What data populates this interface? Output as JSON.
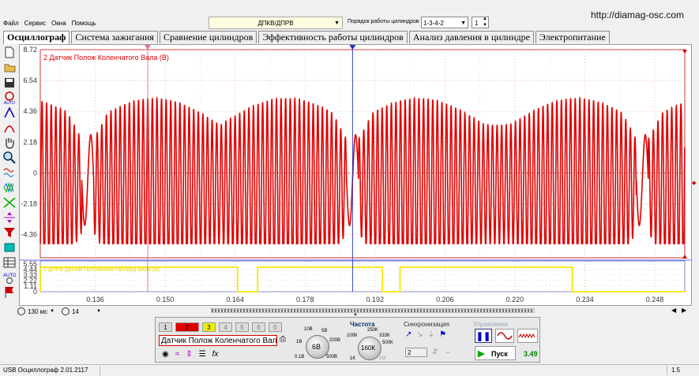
{
  "site": "http://diamag-osc.com",
  "menu": [
    "Файл",
    "Сервис",
    "Окна",
    "Помощь"
  ],
  "sensor_type_combo": "ДПКВ/ДПРВ",
  "cylinder_order": {
    "label": "Порядок работы цилиндров",
    "value": "1-3-4-2",
    "count": "1"
  },
  "tabs": [
    "Осциллограф",
    "Система зажигания",
    "Сравнение цилиндров",
    "Эффективность работы цилиндров",
    "Анализ давления в цилиндре",
    "Электропитание"
  ],
  "chart_data": {
    "type": "line",
    "series": [
      {
        "name": "2 Датчик Полож Коленчатого Вала (В)",
        "color": "#e00000"
      },
      {
        "name": "1 ДПРВ Датчик Положения Распред Вала (В)",
        "color": "#f5e600"
      }
    ],
    "y_ticks_main": [
      "8.72",
      "6.54",
      "4.36",
      "2.18",
      "0",
      "-2.18",
      "-4.36"
    ],
    "y_ticks_lower": [
      "5.55",
      "4.44",
      "3.33",
      "2.22",
      "1.11",
      "0"
    ],
    "x_ticks": [
      "0.136",
      "0.150",
      "0.164",
      "0.178",
      "0.192",
      "0.206",
      "0.220",
      "0.234",
      "0.248"
    ],
    "xlim": [
      0.125,
      0.254
    ],
    "ylim": [
      -6.0,
      8.72
    ],
    "yellow_high_segments": [
      [
        0.125,
        0.1645
      ],
      [
        0.1685,
        0.1935
      ],
      [
        0.197,
        0.2315
      ]
    ],
    "gap_times": [
      0.1345,
      0.1875,
      0.2455
    ],
    "cursor_red": 0.1465,
    "cursor_blue": 0.1875
  },
  "time_control": {
    "timebase": "130 мс",
    "buffer": "14"
  },
  "channels": [
    "1",
    "2",
    "3",
    "4",
    "5",
    "6",
    "0"
  ],
  "channel_colors": {
    "1": "#d8d8d8",
    "2": "#e00000",
    "3": "#f0f000"
  },
  "sensor_name": "Датчик Полож Коленчатого Вала",
  "volt_knob": {
    "value": "6В",
    "labels": [
      "10В",
      "5В",
      "1В",
      "0.1В",
      "200В",
      "500В"
    ]
  },
  "freq": {
    "title": "Частота",
    "value": "160К",
    "labels": [
      "250К",
      "333К",
      "500К",
      "100К",
      "1К",
      "1М"
    ]
  },
  "sync": {
    "title": "Синхронизация",
    "value": "2"
  },
  "control": {
    "title": "Управление",
    "start": "Пуск",
    "value": "3.49"
  },
  "status": {
    "left": "USB Осциллограф  2.01.2117",
    "right": "1.5"
  }
}
